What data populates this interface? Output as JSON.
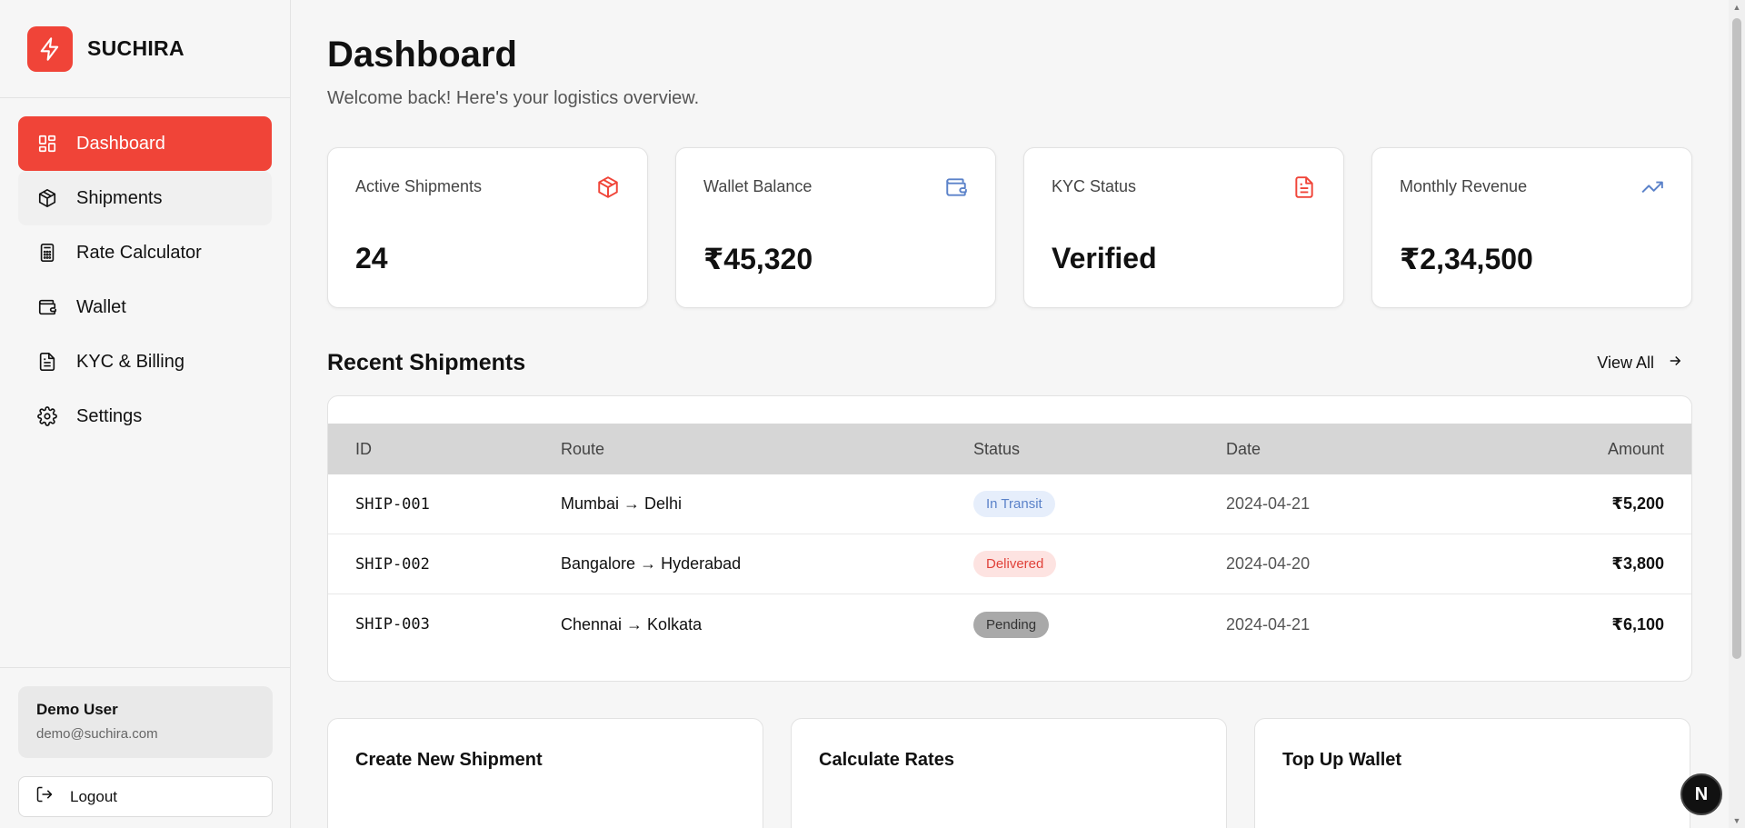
{
  "brand": {
    "name": "SUCHIRA"
  },
  "sidebar": {
    "items": [
      {
        "label": "Dashboard",
        "icon": "dashboard-icon"
      },
      {
        "label": "Shipments",
        "icon": "package-icon"
      },
      {
        "label": "Rate Calculator",
        "icon": "calculator-icon"
      },
      {
        "label": "Wallet",
        "icon": "wallet-icon"
      },
      {
        "label": "KYC & Billing",
        "icon": "document-icon"
      },
      {
        "label": "Settings",
        "icon": "gear-icon"
      }
    ],
    "active_index": 0
  },
  "user": {
    "name": "Demo User",
    "email": "demo@suchira.com",
    "logout_label": "Logout"
  },
  "header": {
    "title": "Dashboard",
    "subtitle": "Welcome back! Here's your logistics overview."
  },
  "stats": [
    {
      "label": "Active Shipments",
      "value": "24",
      "icon": "package-icon"
    },
    {
      "label": "Wallet Balance",
      "value": "₹45,320",
      "icon": "wallet-icon"
    },
    {
      "label": "KYC Status",
      "value": "Verified",
      "icon": "document-icon"
    },
    {
      "label": "Monthly Revenue",
      "value": "₹2,34,500",
      "icon": "trending-up-icon"
    }
  ],
  "recent": {
    "title": "Recent Shipments",
    "view_all": "View All",
    "columns": [
      "ID",
      "Route",
      "Status",
      "Date",
      "Amount"
    ],
    "rows": [
      {
        "id": "SHIP-001",
        "route": "Mumbai → Delhi",
        "status": "In Transit",
        "date": "2024-04-21",
        "amount": "₹5,200"
      },
      {
        "id": "SHIP-002",
        "route": "Bangalore → Hyderabad",
        "status": "Delivered",
        "date": "2024-04-20",
        "amount": "₹3,800"
      },
      {
        "id": "SHIP-003",
        "route": "Chennai → Kolkata",
        "status": "Pending",
        "date": "2024-04-21",
        "amount": "₹6,100"
      }
    ]
  },
  "actions": [
    {
      "title": "Create New Shipment"
    },
    {
      "title": "Calculate Rates"
    },
    {
      "title": "Top Up Wallet"
    }
  ],
  "fab": {
    "label": "N"
  },
  "colors": {
    "accent": "#f04438",
    "transit": "#5b82c9",
    "delivered": "#e0423a",
    "pending": "#a9a9a9"
  }
}
